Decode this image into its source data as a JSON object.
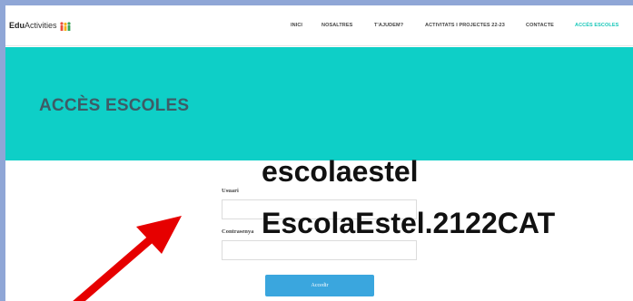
{
  "header": {
    "logo_prefix": "Edu",
    "logo_suffix": "Activities",
    "logo_icon": "people-icon",
    "nav": [
      {
        "label": "INICI"
      },
      {
        "label": "NOSALTRES"
      },
      {
        "label": "T'AJUDEM?"
      },
      {
        "label": "ACTIVITATS I PROJECTES 22-23"
      },
      {
        "label": "CONTACTE"
      },
      {
        "label": "ACCÉS ESCOLES",
        "active": true
      }
    ]
  },
  "hero": {
    "title": "ACCÈS ESCOLES"
  },
  "login": {
    "user_label": "Usuari",
    "user_value": "",
    "password_label": "Contrasenya",
    "password_value": "",
    "submit_label": "Accedir"
  },
  "annotation": {
    "username": "escolaestel",
    "password": "EscolaEstel.2122CAT",
    "arrow_icon": "red-arrow-icon"
  },
  "colors": {
    "hero_bg": "#0ecfc7",
    "active_nav": "#17c7b9",
    "button": "#3aa6de",
    "arrow": "#e60000",
    "outer_border": "#8fa6d6"
  }
}
